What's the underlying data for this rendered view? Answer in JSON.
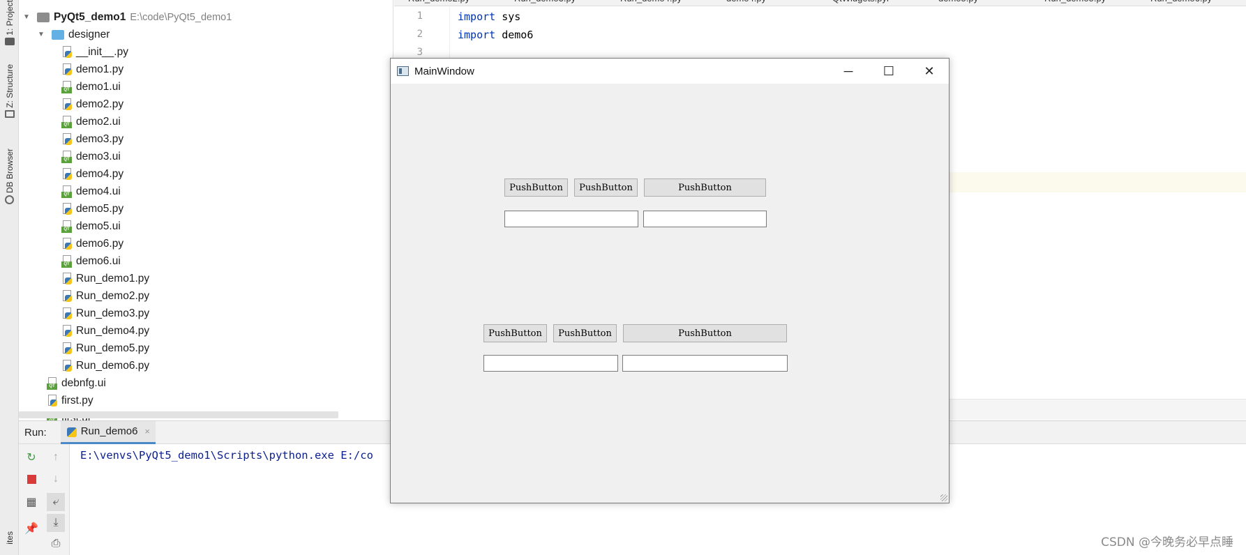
{
  "tool_strip": {
    "tabs": [
      {
        "label": "1: Project",
        "icon": "folder-icon"
      },
      {
        "label": "Z: Structure",
        "icon": "structure-icon"
      },
      {
        "label": "DB Browser",
        "icon": "db-icon"
      },
      {
        "label": "ites",
        "icon": ""
      }
    ]
  },
  "project": {
    "root": {
      "name": "PyQt5_demo1",
      "path": "E:\\code\\PyQt5_demo1"
    },
    "folder": {
      "name": "designer"
    },
    "files": [
      {
        "name": "__init__.py",
        "type": "py"
      },
      {
        "name": "demo1.py",
        "type": "py"
      },
      {
        "name": "demo1.ui",
        "type": "ui"
      },
      {
        "name": "demo2.py",
        "type": "py"
      },
      {
        "name": "demo2.ui",
        "type": "ui"
      },
      {
        "name": "demo3.py",
        "type": "py"
      },
      {
        "name": "demo3.ui",
        "type": "ui"
      },
      {
        "name": "demo4.py",
        "type": "py"
      },
      {
        "name": "demo4.ui",
        "type": "ui"
      },
      {
        "name": "demo5.py",
        "type": "py"
      },
      {
        "name": "demo5.ui",
        "type": "ui"
      },
      {
        "name": "demo6.py",
        "type": "py"
      },
      {
        "name": "demo6.ui",
        "type": "ui"
      },
      {
        "name": "Run_demo1.py",
        "type": "py"
      },
      {
        "name": "Run_demo2.py",
        "type": "py"
      },
      {
        "name": "Run_demo3.py",
        "type": "py"
      },
      {
        "name": "Run_demo4.py",
        "type": "py"
      },
      {
        "name": "Run_demo5.py",
        "type": "py"
      },
      {
        "name": "Run_demo6.py",
        "type": "py"
      }
    ],
    "root_files": [
      {
        "name": "debnfg.ui",
        "type": "ui"
      },
      {
        "name": "first.py",
        "type": "py"
      },
      {
        "name": "first.ui",
        "type": "ui"
      }
    ]
  },
  "editor": {
    "tabs": [
      "Run_demo2.py",
      "Run_demo3.py",
      "Run_demo4.py",
      "demo4.py",
      "QtWidgets.pyi",
      "demo5.py",
      "Run_demo5.py",
      "Run_demo6.py"
    ],
    "line_numbers": [
      "1",
      "2",
      "3"
    ],
    "lines": [
      {
        "keyword": "import",
        "rest": " sys"
      },
      {
        "keyword": "import",
        "rest": " demo6"
      }
    ]
  },
  "run": {
    "label": "Run:",
    "tab": "Run_demo6",
    "tab_close": "×",
    "console": "E:\\venvs\\PyQt5_demo1\\Scripts\\python.exe E:/co"
  },
  "qt_window": {
    "title": "MainWindow",
    "minimize": "─",
    "maximize": "☐",
    "close": "✕",
    "group1": {
      "buttons": [
        "PushButton",
        "PushButton",
        "PushButton"
      ]
    },
    "group2": {
      "buttons": [
        "PushButton",
        "PushButton",
        "PushButton"
      ]
    }
  },
  "watermark": "CSDN @今晚务必早点睡",
  "colors": {
    "keyword": "#0033b3",
    "console": "#0a1e8f",
    "run_tab_accent": "#4a88c7"
  }
}
